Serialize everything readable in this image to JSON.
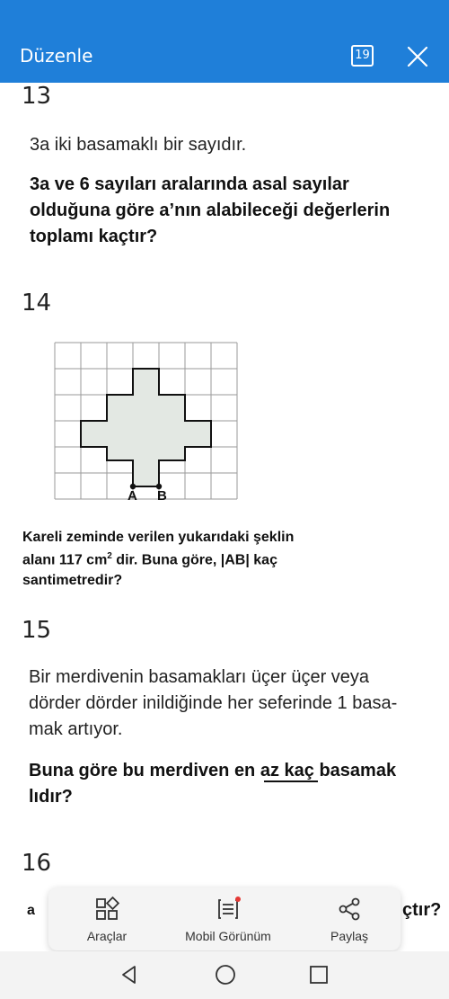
{
  "header": {
    "title": "Düzenle",
    "page_badge": "19",
    "background": "#1f7fd9"
  },
  "questions": {
    "q13": {
      "number": "13",
      "intro": "3a iki basamaklı bir sayıdır.",
      "bold_lines": [
        "3a ve 6 sayıları aralarında asal sayılar",
        "olduğuna göre a’nın alabileceği değerlerin",
        "toplamı kaçtır?"
      ]
    },
    "q14": {
      "number": "14",
      "point_a": "A",
      "point_b": "B",
      "lines": [
        "Kareli zeminde verilen yukarıdaki şeklin",
        "alanı 117 cm",
        "2",
        " dir. Buna göre, |AB| kaç",
        "santimetredir?"
      ]
    },
    "q15": {
      "number": "15",
      "reg_lines": [
        "Bir merdivenin basamakları üçer üçer veya",
        "dörder dörder inildiğinde her seferinde 1 basa-",
        "mak artıyor."
      ],
      "bold_pre": "Buna göre bu merdiven ",
      "bold_under": "en az",
      "bold_post": " kaç basamak",
      "bold_line2": "lıdır?"
    },
    "q16": {
      "number": "16",
      "partial_left": "a",
      "partial_right": "çtır?"
    }
  },
  "toolbar": {
    "items": [
      {
        "label": "Araçlar",
        "icon": "tools-grid-icon"
      },
      {
        "label": "Mobil Görünüm",
        "icon": "mobile-view-icon"
      },
      {
        "label": "Paylaş",
        "icon": "share-icon"
      }
    ],
    "notification_dot_color": "#e53935"
  },
  "navbar": {
    "icons": [
      "back-icon",
      "home-icon",
      "recents-icon"
    ]
  }
}
